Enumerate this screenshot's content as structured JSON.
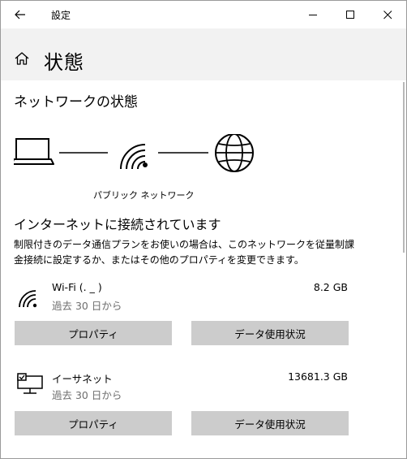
{
  "window": {
    "title": "設定"
  },
  "header": {
    "page_title": "状態"
  },
  "main": {
    "section_title": "ネットワークの状態",
    "network_type_label": "パブリック ネットワーク",
    "connection_status": "インターネットに接続されています",
    "description": "制限付きのデータ通信プランをお使いの場合は、このネットワークを従量制課金接続に設定するか、またはその他のプロパティを変更できます。"
  },
  "connections": [
    {
      "icon": "wifi-icon",
      "name": "Wi-Fi (.         _   )",
      "period": "過去 30 日から",
      "usage": "8.2 GB",
      "properties_label": "プロパティ",
      "data_usage_label": "データ使用状況"
    },
    {
      "icon": "ethernet-icon",
      "name": "イーサネット",
      "period": "過去 30 日から",
      "usage": "13681.3 GB",
      "properties_label": "プロパティ",
      "data_usage_label": "データ使用状況"
    }
  ],
  "colors": {
    "header_bg": "#f2f2f2",
    "button_bg": "#cccccc",
    "secondary_text": "#6e6e6e"
  }
}
